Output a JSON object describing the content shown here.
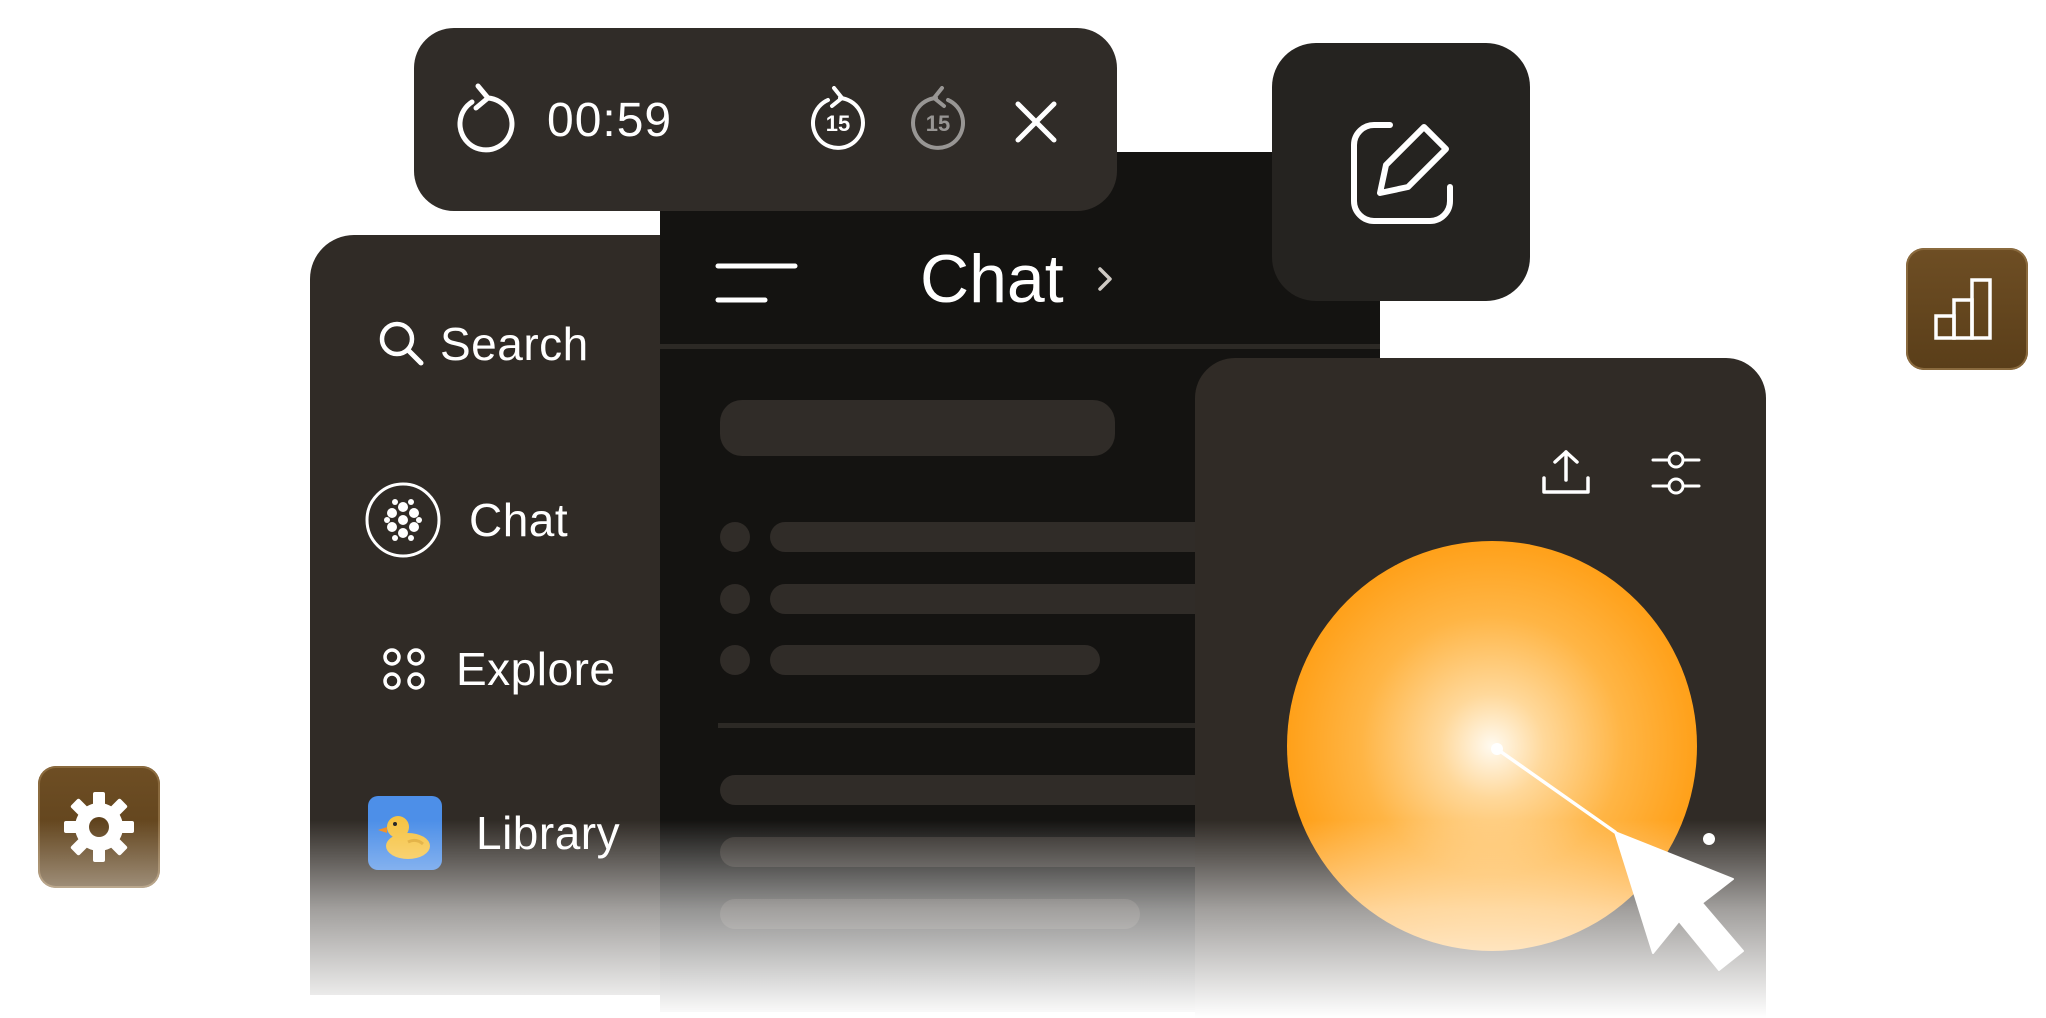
{
  "timer": {
    "time": "00:59",
    "skip_back_seconds": "15",
    "skip_forward_seconds": "15",
    "icons": [
      "replay-icon",
      "skip-back-15-icon",
      "skip-forward-15-icon",
      "close-icon"
    ]
  },
  "chat_header": {
    "title": "Chat"
  },
  "sidebar": {
    "items": [
      {
        "label": "Search",
        "icon": "search-icon"
      },
      {
        "label": "Chat",
        "icon": "chat-app-icon"
      },
      {
        "label": "Explore",
        "icon": "explore-grid-icon"
      },
      {
        "label": "Library",
        "icon": "duck-icon"
      }
    ]
  },
  "colors": {
    "accent_orange": "#ff9800",
    "panel_dark": "#302b26",
    "panel_darker": "#141311",
    "tile_brown": "#5a3e19"
  }
}
